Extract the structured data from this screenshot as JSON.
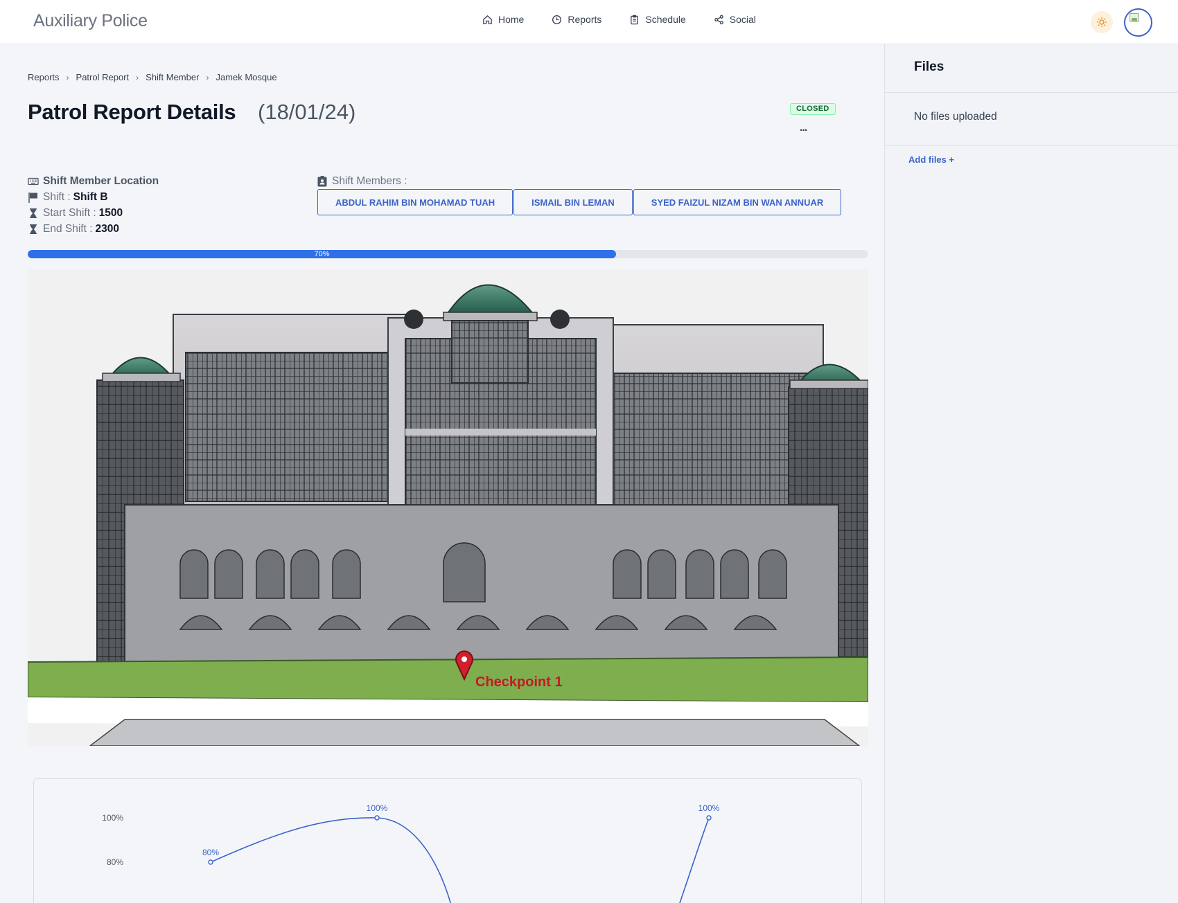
{
  "app": {
    "brand": "Auxiliary Police"
  },
  "nav": [
    {
      "label": "Home",
      "icon": "home-icon"
    },
    {
      "label": "Reports",
      "icon": "clock-icon"
    },
    {
      "label": "Schedule",
      "icon": "clipboard-icon"
    },
    {
      "label": "Social",
      "icon": "share-icon"
    }
  ],
  "header_actions": {
    "theme_icon": "sun-icon",
    "avatar": "user-avatar"
  },
  "breadcrumb": [
    "Reports",
    "Patrol Report",
    "Shift Member",
    "Jamek Mosque"
  ],
  "page": {
    "title": "Patrol Report Details",
    "date": "(18/01/24)",
    "status": "CLOSED",
    "more": "..."
  },
  "info": {
    "location_label": "Shift Member Location",
    "shift_label": "Shift :",
    "shift_value": "Shift B",
    "start_label": "Start Shift :",
    "start_value": "1500",
    "end_label": "End Shift :",
    "end_value": "2300"
  },
  "members": {
    "label": "Shift Members :",
    "list": [
      "ABDUL RAHIM BIN MOHAMAD TUAH",
      "ISMAIL BIN LEMAN",
      "SYED FAIZUL NIZAM BIN WAN ANNUAR"
    ]
  },
  "progress": {
    "value": 70,
    "label": "70%"
  },
  "photo": {
    "marker_text": "Checkpoint 1"
  },
  "colors": {
    "accent": "#3b63c9",
    "progress": "#2f6fe9",
    "status_bg": "#dcfce7",
    "status_text": "#166534"
  },
  "chart_data": {
    "type": "line",
    "y_tick_labels": [
      "100%",
      "80%"
    ],
    "data_labels": [
      "80%",
      "100%",
      "100%"
    ],
    "values": [
      80,
      100,
      100
    ],
    "note_visible": "partial chart, curve dips below visible area between points"
  },
  "files": {
    "title": "Files",
    "empty_text": "No files uploaded",
    "add_label": "Add files +"
  }
}
